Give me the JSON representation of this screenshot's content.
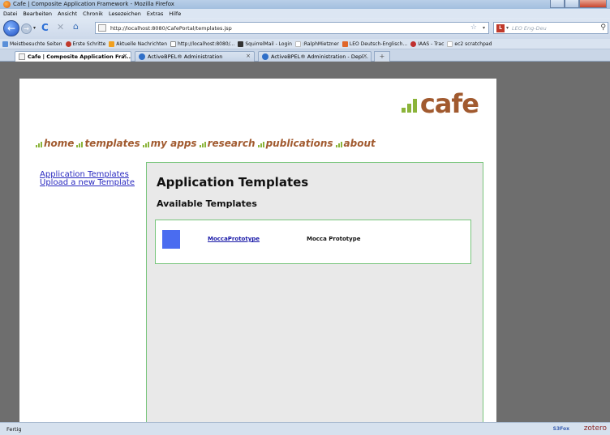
{
  "window": {
    "title": "Cafe | Composite Application Framework - Mozilla Firefox"
  },
  "menu": [
    "Datei",
    "Bearbeiten",
    "Ansicht",
    "Chronik",
    "Lesezeichen",
    "Extras",
    "Hilfe"
  ],
  "navbar": {
    "url": "http://localhost:8080/CafePortal/templates.jsp",
    "search_placeholder": "LEO Eng-Deu",
    "search_engine_icon": "leo-icon"
  },
  "bookmarks": [
    {
      "label": "Meistbesuchte Seiten",
      "color": "#5a8fd8"
    },
    {
      "label": "Erste Schritte",
      "color": "#c0392b"
    },
    {
      "label": "Aktuelle Nachrichten",
      "color": "#f0a020"
    },
    {
      "label": "http://localhost:8080/...",
      "color": "#8a8a8a"
    },
    {
      "label": "SquirrelMail - Login",
      "color": "#333333"
    },
    {
      "label": ":RalphMietzner",
      "color": "#bbbbbb"
    },
    {
      "label": "LEO Deutsch-Englisch...",
      "color": "#e0662a"
    },
    {
      "label": "IAAS - Trac",
      "color": "#c03030"
    },
    {
      "label": "ec2 scratchpad",
      "color": "#bbbbbb"
    }
  ],
  "tabs": [
    {
      "label": "Cafe | Composite Application Fra...",
      "active": true
    },
    {
      "label": "ActiveBPEL® Administration",
      "active": false
    },
    {
      "label": "ActiveBPEL® Administration - Depl...",
      "active": false
    }
  ],
  "page": {
    "logo_text": "cafe",
    "nav": [
      "home",
      "templates",
      "my apps",
      "research",
      "publications",
      "about"
    ],
    "side_links": [
      "Application Templates",
      "Upload a new Template"
    ],
    "heading": "Application Templates",
    "subheading": "Available Templates",
    "templates": [
      {
        "name": "MoccaPrototype",
        "description": "Mocca Prototype",
        "thumb_color": "#4a6cf0"
      }
    ]
  },
  "status": {
    "text": "Fertig",
    "s3fox": "S3Fox",
    "zotero": "zotero"
  },
  "colors": {
    "brand": "#a15a2f",
    "accent_green": "#8bb43a",
    "panel_border": "#78c57c",
    "link": "#2a2ac0"
  }
}
